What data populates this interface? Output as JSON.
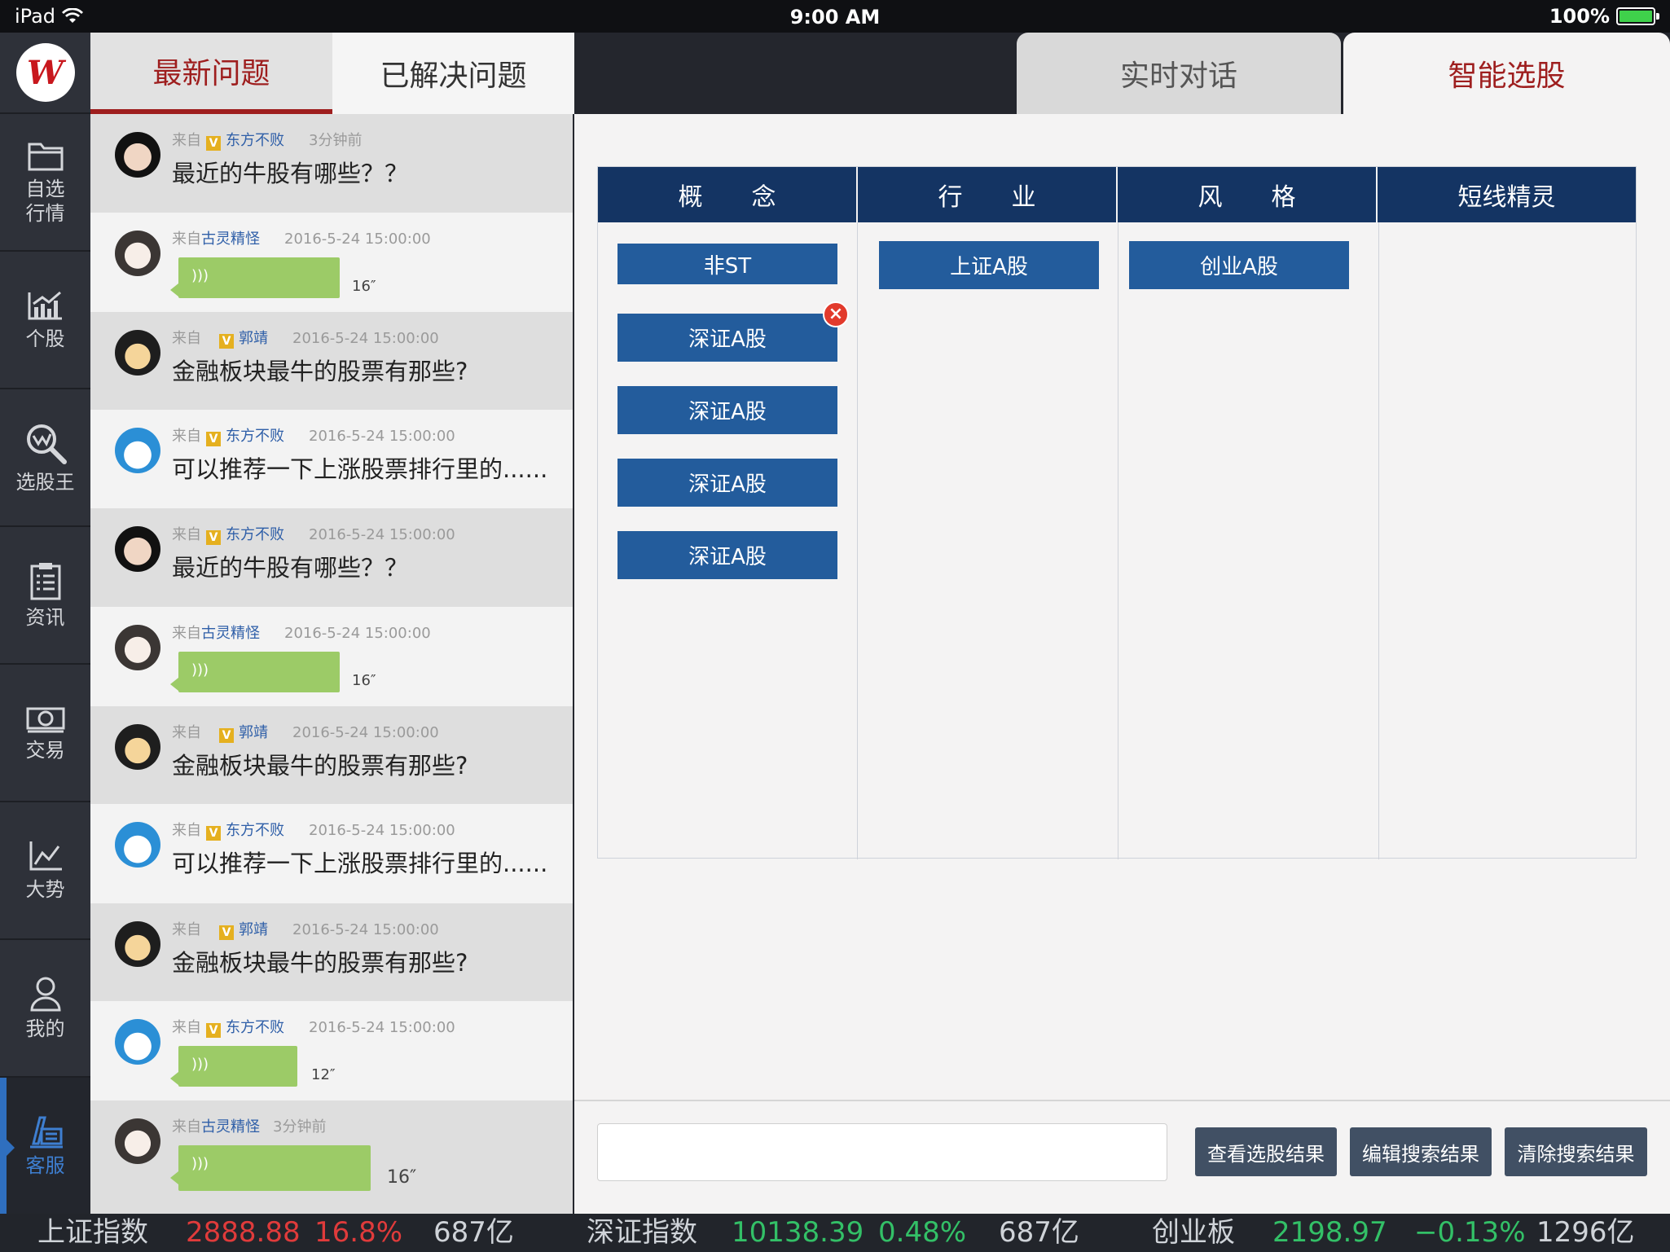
{
  "status_bar": {
    "device": "iPad",
    "time": "9:00 AM",
    "battery": "100%",
    "battery_level": 1.0
  },
  "app": {
    "logo_letter": "W"
  },
  "sidebar": {
    "items": [
      {
        "label_line1": "自选",
        "label_line2": "行情",
        "icon": "folder-icon"
      },
      {
        "label_line1": "个股",
        "label_line2": "",
        "icon": "bar-chart-icon"
      },
      {
        "label_line1": "选股王",
        "label_line2": "",
        "icon": "search-icon"
      },
      {
        "label_line1": "资讯",
        "label_line2": "",
        "icon": "clipboard-icon"
      },
      {
        "label_line1": "交易",
        "label_line2": "",
        "icon": "money-icon"
      },
      {
        "label_line1": "大势",
        "label_line2": "",
        "icon": "trend-icon"
      },
      {
        "label_line1": "我的",
        "label_line2": "",
        "icon": "user-icon"
      },
      {
        "label_line1": "客服",
        "label_line2": "",
        "icon": "service-icon",
        "active": true
      }
    ]
  },
  "question_tabs": [
    {
      "label": "最新问题",
      "active": true
    },
    {
      "label": "已解决问题",
      "active": false
    }
  ],
  "questions": [
    {
      "from": "来自",
      "name": "东方不败",
      "vip": true,
      "vip_label": "V",
      "time": "3分钟前",
      "text": "最近的牛股有哪些？？",
      "avatar_color": "#111111"
    },
    {
      "from": "来自",
      "name": "古灵精怪",
      "vip": false,
      "vip_label": "",
      "time": "2016-5-24  15:00:00",
      "voice": "16″",
      "avatar_color": "#c9c2bd"
    },
    {
      "from": "来自",
      "name": "郭靖",
      "vip": true,
      "vip_label": "V",
      "time": "2016-5-24  15:00:00",
      "text": "金融板块最牛的股票有那些?",
      "avatar_color": "#2a2a2a"
    },
    {
      "from": "来自",
      "name": "东方不败",
      "vip": true,
      "vip_label": "V",
      "time": "2016-5-24  15:00:00",
      "text": "可以推荐一下上涨股票排行里的......",
      "avatar_color": "#2b8fd6"
    },
    {
      "from": "来自",
      "name": "东方不败",
      "vip": true,
      "vip_label": "V",
      "time": "2016-5-24  15:00:00",
      "text": "最近的牛股有哪些？？",
      "avatar_color": "#111111"
    },
    {
      "from": "来自",
      "name": "古灵精怪",
      "vip": false,
      "vip_label": "",
      "time": "2016-5-24  15:00:00",
      "voice": "16″",
      "avatar_color": "#c9c2bd"
    },
    {
      "from": "来自",
      "name": "郭靖",
      "vip": true,
      "vip_label": "V",
      "time": "2016-5-24  15:00:00",
      "text": "金融板块最牛的股票有那些?",
      "avatar_color": "#2a2a2a"
    },
    {
      "from": "来自",
      "name": "东方不败",
      "vip": true,
      "vip_label": "V",
      "time": "2016-5-24  15:00:00",
      "text": "可以推荐一下上涨股票排行里的......",
      "avatar_color": "#2b8fd6"
    },
    {
      "from": "来自",
      "name": "郭靖",
      "vip": true,
      "vip_label": "V",
      "time": "2016-5-24  15:00:00",
      "text": "金融板块最牛的股票有那些?",
      "avatar_color": "#2a2a2a"
    },
    {
      "from": "来自",
      "name": "东方不败",
      "vip": true,
      "vip_label": "V",
      "time": "2016-5-24  15:00:00",
      "voice": "12″",
      "avatar_color": "#2b8fd6"
    },
    {
      "from": "来自",
      "name": "古灵精怪",
      "vip": false,
      "vip_label": "",
      "time": "3分钟前",
      "voice": "16″",
      "avatar_color": "#c9c2bd"
    }
  ],
  "top_tabs": [
    {
      "label": "实时对话",
      "active": false
    },
    {
      "label": "智能选股",
      "active": true
    }
  ],
  "picker": {
    "headers": [
      "概　　念",
      "行　　业",
      "风　　格",
      "短线精灵"
    ],
    "concept": [
      "非ST",
      "深证A股",
      "深证A股",
      "深证A股",
      "深证A股"
    ],
    "industry": [
      "上证A股"
    ],
    "style": [
      "创业A股"
    ],
    "short": []
  },
  "search": {
    "value": "",
    "placeholder": ""
  },
  "buttons": {
    "view": "查看选股结果",
    "edit": "编辑搜索结果",
    "clear": "清除搜索结果"
  },
  "ticker": [
    {
      "name": "上证指数",
      "value": "2888.88",
      "pct": "16.8%",
      "vol": "687亿",
      "trend": "up"
    },
    {
      "name": "深证指数",
      "value": "10138.39",
      "pct": "0.48%",
      "vol": "687亿",
      "trend": "up-green"
    },
    {
      "name": "创业板",
      "value": "2198.97",
      "pct": "−0.13%",
      "vol": "1296亿",
      "trend": "down"
    }
  ],
  "colors": {
    "accent": "#9e1e1e",
    "header": "#143463",
    "chip": "#235c9c",
    "voice": "#9ccb67",
    "up": "#e03b3b",
    "down": "#33c067"
  }
}
